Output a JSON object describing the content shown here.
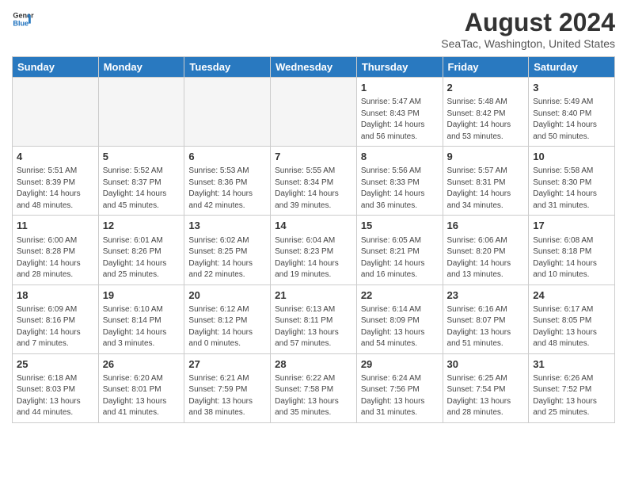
{
  "header": {
    "logo_line1": "General",
    "logo_line2": "Blue",
    "main_title": "August 2024",
    "subtitle": "SeaTac, Washington, United States"
  },
  "calendar": {
    "days_of_week": [
      "Sunday",
      "Monday",
      "Tuesday",
      "Wednesday",
      "Thursday",
      "Friday",
      "Saturday"
    ],
    "weeks": [
      [
        {
          "day": "",
          "info": ""
        },
        {
          "day": "",
          "info": ""
        },
        {
          "day": "",
          "info": ""
        },
        {
          "day": "",
          "info": ""
        },
        {
          "day": "1",
          "info": "Sunrise: 5:47 AM\nSunset: 8:43 PM\nDaylight: 14 hours\nand 56 minutes."
        },
        {
          "day": "2",
          "info": "Sunrise: 5:48 AM\nSunset: 8:42 PM\nDaylight: 14 hours\nand 53 minutes."
        },
        {
          "day": "3",
          "info": "Sunrise: 5:49 AM\nSunset: 8:40 PM\nDaylight: 14 hours\nand 50 minutes."
        }
      ],
      [
        {
          "day": "4",
          "info": "Sunrise: 5:51 AM\nSunset: 8:39 PM\nDaylight: 14 hours\nand 48 minutes."
        },
        {
          "day": "5",
          "info": "Sunrise: 5:52 AM\nSunset: 8:37 PM\nDaylight: 14 hours\nand 45 minutes."
        },
        {
          "day": "6",
          "info": "Sunrise: 5:53 AM\nSunset: 8:36 PM\nDaylight: 14 hours\nand 42 minutes."
        },
        {
          "day": "7",
          "info": "Sunrise: 5:55 AM\nSunset: 8:34 PM\nDaylight: 14 hours\nand 39 minutes."
        },
        {
          "day": "8",
          "info": "Sunrise: 5:56 AM\nSunset: 8:33 PM\nDaylight: 14 hours\nand 36 minutes."
        },
        {
          "day": "9",
          "info": "Sunrise: 5:57 AM\nSunset: 8:31 PM\nDaylight: 14 hours\nand 34 minutes."
        },
        {
          "day": "10",
          "info": "Sunrise: 5:58 AM\nSunset: 8:30 PM\nDaylight: 14 hours\nand 31 minutes."
        }
      ],
      [
        {
          "day": "11",
          "info": "Sunrise: 6:00 AM\nSunset: 8:28 PM\nDaylight: 14 hours\nand 28 minutes."
        },
        {
          "day": "12",
          "info": "Sunrise: 6:01 AM\nSunset: 8:26 PM\nDaylight: 14 hours\nand 25 minutes."
        },
        {
          "day": "13",
          "info": "Sunrise: 6:02 AM\nSunset: 8:25 PM\nDaylight: 14 hours\nand 22 minutes."
        },
        {
          "day": "14",
          "info": "Sunrise: 6:04 AM\nSunset: 8:23 PM\nDaylight: 14 hours\nand 19 minutes."
        },
        {
          "day": "15",
          "info": "Sunrise: 6:05 AM\nSunset: 8:21 PM\nDaylight: 14 hours\nand 16 minutes."
        },
        {
          "day": "16",
          "info": "Sunrise: 6:06 AM\nSunset: 8:20 PM\nDaylight: 14 hours\nand 13 minutes."
        },
        {
          "day": "17",
          "info": "Sunrise: 6:08 AM\nSunset: 8:18 PM\nDaylight: 14 hours\nand 10 minutes."
        }
      ],
      [
        {
          "day": "18",
          "info": "Sunrise: 6:09 AM\nSunset: 8:16 PM\nDaylight: 14 hours\nand 7 minutes."
        },
        {
          "day": "19",
          "info": "Sunrise: 6:10 AM\nSunset: 8:14 PM\nDaylight: 14 hours\nand 3 minutes."
        },
        {
          "day": "20",
          "info": "Sunrise: 6:12 AM\nSunset: 8:12 PM\nDaylight: 14 hours\nand 0 minutes."
        },
        {
          "day": "21",
          "info": "Sunrise: 6:13 AM\nSunset: 8:11 PM\nDaylight: 13 hours\nand 57 minutes."
        },
        {
          "day": "22",
          "info": "Sunrise: 6:14 AM\nSunset: 8:09 PM\nDaylight: 13 hours\nand 54 minutes."
        },
        {
          "day": "23",
          "info": "Sunrise: 6:16 AM\nSunset: 8:07 PM\nDaylight: 13 hours\nand 51 minutes."
        },
        {
          "day": "24",
          "info": "Sunrise: 6:17 AM\nSunset: 8:05 PM\nDaylight: 13 hours\nand 48 minutes."
        }
      ],
      [
        {
          "day": "25",
          "info": "Sunrise: 6:18 AM\nSunset: 8:03 PM\nDaylight: 13 hours\nand 44 minutes."
        },
        {
          "day": "26",
          "info": "Sunrise: 6:20 AM\nSunset: 8:01 PM\nDaylight: 13 hours\nand 41 minutes."
        },
        {
          "day": "27",
          "info": "Sunrise: 6:21 AM\nSunset: 7:59 PM\nDaylight: 13 hours\nand 38 minutes."
        },
        {
          "day": "28",
          "info": "Sunrise: 6:22 AM\nSunset: 7:58 PM\nDaylight: 13 hours\nand 35 minutes."
        },
        {
          "day": "29",
          "info": "Sunrise: 6:24 AM\nSunset: 7:56 PM\nDaylight: 13 hours\nand 31 minutes."
        },
        {
          "day": "30",
          "info": "Sunrise: 6:25 AM\nSunset: 7:54 PM\nDaylight: 13 hours\nand 28 minutes."
        },
        {
          "day": "31",
          "info": "Sunrise: 6:26 AM\nSunset: 7:52 PM\nDaylight: 13 hours\nand 25 minutes."
        }
      ]
    ]
  }
}
